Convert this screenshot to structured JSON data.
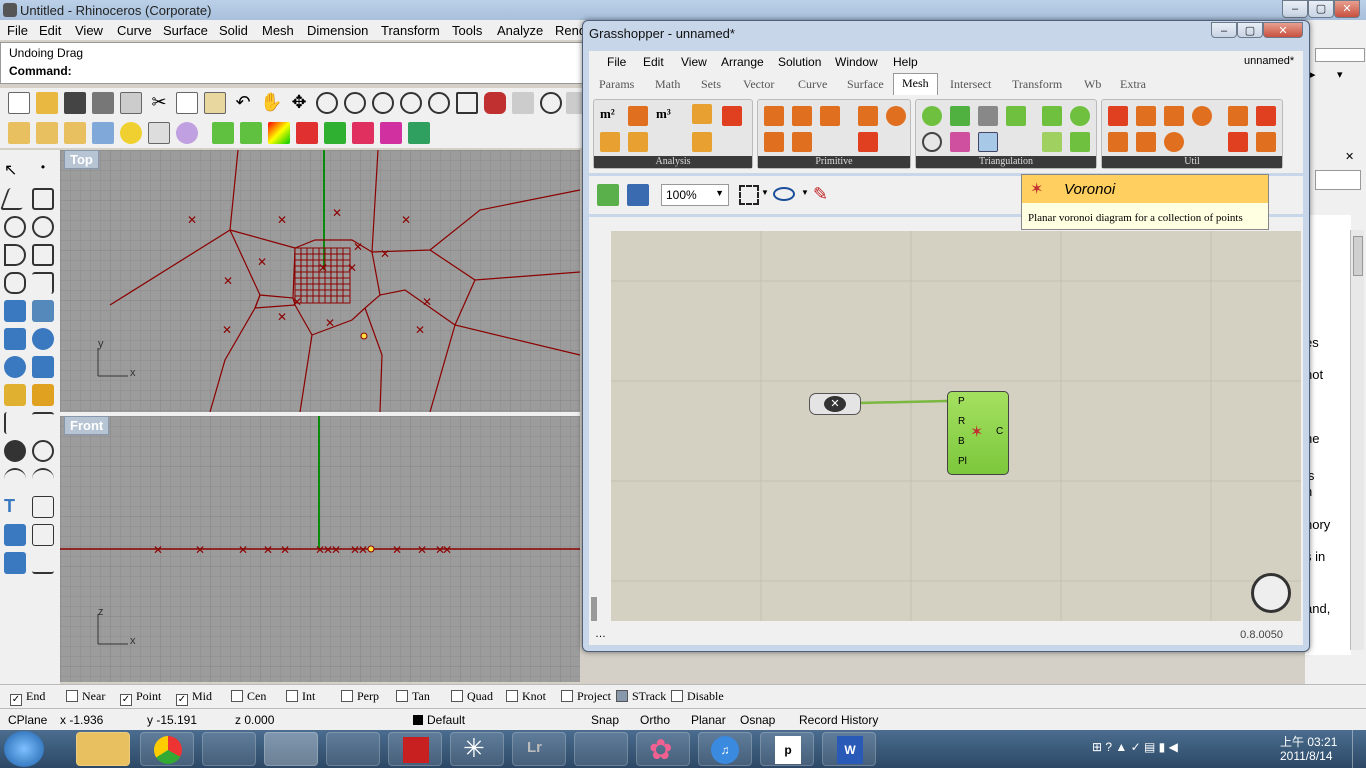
{
  "rhino": {
    "title": "Untitled - Rhinoceros (Corporate)",
    "menu": [
      "File",
      "Edit",
      "View",
      "Curve",
      "Surface",
      "Solid",
      "Mesh",
      "Dimension",
      "Transform",
      "Tools",
      "Analyze",
      "Rend"
    ],
    "command_history": "Undoing Drag",
    "command_prompt": "Command:",
    "viewports": {
      "top": "Top",
      "front": "Front"
    },
    "axis_labels": {
      "x": "x",
      "y": "y",
      "z": "z"
    },
    "snaps": [
      {
        "label": "End",
        "checked": true
      },
      {
        "label": "Near",
        "checked": false
      },
      {
        "label": "Point",
        "checked": true
      },
      {
        "label": "Mid",
        "checked": true
      },
      {
        "label": "Cen",
        "checked": false
      },
      {
        "label": "Int",
        "checked": false
      },
      {
        "label": "Perp",
        "checked": false
      },
      {
        "label": "Tan",
        "checked": false
      },
      {
        "label": "Quad",
        "checked": false
      },
      {
        "label": "Knot",
        "checked": false
      },
      {
        "label": "Project",
        "checked": false
      },
      {
        "label": "STrack",
        "checked": false
      },
      {
        "label": "Disable",
        "checked": false
      }
    ],
    "status": {
      "cplane": "CPlane",
      "x": "x -1.936",
      "y": "y -15.191",
      "z": "z 0.000",
      "layer": "Default",
      "modes": [
        "Snap",
        "Ortho",
        "Planar",
        "Osnap",
        "Record History"
      ]
    }
  },
  "grasshopper": {
    "title": "Grasshopper - unnamed*",
    "menu": [
      "File",
      "Edit",
      "View",
      "Arrange",
      "Solution",
      "Window",
      "Help"
    ],
    "doc_name": "unnamed*",
    "tabs": [
      "Params",
      "Math",
      "Sets",
      "Vector",
      "Curve",
      "Surface",
      "Mesh",
      "Intersect",
      "Transform",
      "Wb",
      "Extra"
    ],
    "active_tab": "Mesh",
    "groups": [
      "Analysis",
      "Primitive",
      "Triangulation",
      "Util"
    ],
    "zoom": "100%",
    "tooltip_title": "Voronoi",
    "tooltip_desc": "Planar voronoi diagram for a collection of points",
    "component_inputs": [
      "P",
      "R",
      "B",
      "Pl"
    ],
    "component_output": "C",
    "version": "0.8.0050"
  },
  "clock": {
    "time": "上午 03:21",
    "date": "2011/8/14"
  },
  "right_panel_fragments": [
    "es",
    "not",
    "he",
    "is",
    "n",
    "nory",
    "s in",
    "and,"
  ],
  "colors": {
    "accent": "#8b0000",
    "component": "#8ed14a",
    "tooltip_head": "#ffd060"
  }
}
